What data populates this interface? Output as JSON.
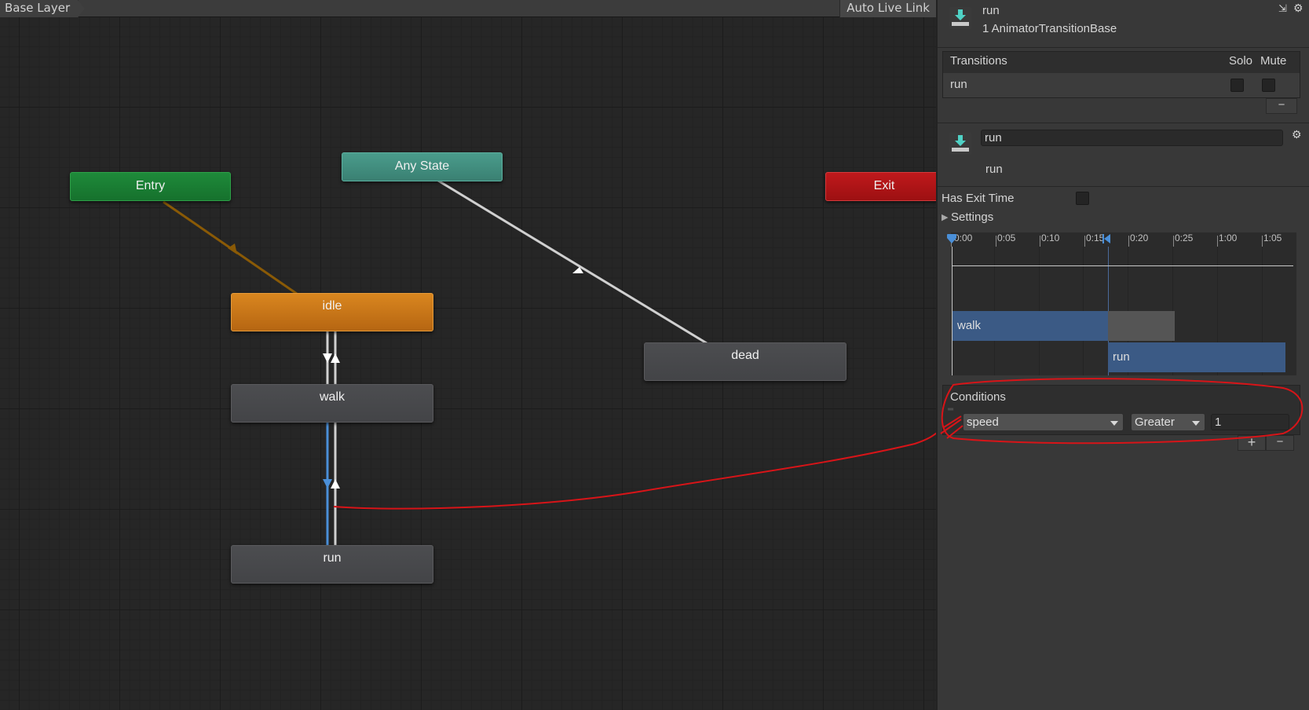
{
  "graph": {
    "breadcrumb": "Base Layer",
    "auto_live_link": "Auto Live Link",
    "nodes": {
      "entry": "Entry",
      "any_state": "Any State",
      "exit": "Exit",
      "idle": "idle",
      "walk": "walk",
      "run": "run",
      "dead": "dead"
    }
  },
  "inspector": {
    "header": {
      "name": "run",
      "subtitle": "1 AnimatorTransitionBase"
    },
    "transitions": {
      "header": "Transitions",
      "solo": "Solo",
      "mute": "Mute",
      "items": [
        {
          "label": "run"
        }
      ],
      "remove_label": "−"
    },
    "transition": {
      "name_value": "run",
      "label": "run"
    },
    "has_exit_time_label": "Has Exit Time",
    "settings_label": "Settings",
    "timeline": {
      "ticks": [
        "0:00",
        "0:05",
        "0:10",
        "0:15",
        "0:20",
        "0:25",
        "1:00",
        "1:05"
      ],
      "clips": {
        "walk": "walk",
        "run": "run"
      }
    },
    "conditions": {
      "header": "Conditions",
      "parameter": "speed",
      "mode": "Greater",
      "threshold": "1",
      "add_label": "+",
      "remove_label": "−"
    }
  },
  "colors": {
    "entry": "#1e8a3a",
    "any_state": "#4a9c8c",
    "exit": "#c0191c",
    "idle": "#d9861f",
    "selected_transition": "#4a8fd8",
    "annotation": "#d81418"
  }
}
